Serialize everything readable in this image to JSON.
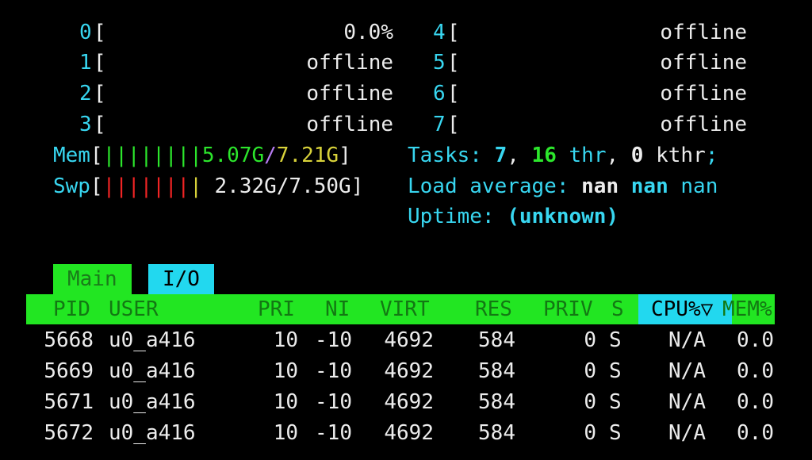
{
  "cpus": [
    {
      "id": "0",
      "value": "0.0%"
    },
    {
      "id": "1",
      "value": "offline"
    },
    {
      "id": "2",
      "value": "offline"
    },
    {
      "id": "3",
      "value": "offline"
    },
    {
      "id": "4",
      "value": "offline"
    },
    {
      "id": "5",
      "value": "offline"
    },
    {
      "id": "6",
      "value": "offline"
    },
    {
      "id": "7",
      "value": "offline"
    }
  ],
  "meters": {
    "mem": {
      "label": "Mem",
      "bars": "||||||||",
      "used": "5.07G",
      "sep": "/",
      "total": "7.21G"
    },
    "swp": {
      "label": "Swp",
      "bars_red": "|||||||",
      "bars_yellow": "|",
      "value": "2.32G/7.50G"
    }
  },
  "info": {
    "tasks_label": "Tasks: ",
    "tasks_count": "7",
    "tasks_comma1": ", ",
    "threads": "16",
    "threads_label": " thr",
    "tasks_comma2": ", ",
    "kthreads": "0",
    "kthreads_label": " kthr",
    "tasks_end": ";",
    "load_label": "Load average: ",
    "load_1": "nan",
    "load_5": "nan",
    "load_15": "nan",
    "uptime_label": "Uptime: ",
    "uptime_value": "(unknown)"
  },
  "tabs": {
    "main": "Main",
    "io": "I/O"
  },
  "columns": {
    "pid": "PID",
    "user": "USER",
    "pri": "PRI",
    "ni": "NI",
    "virt": "VIRT",
    "res": "RES",
    "priv": "PRIV",
    "s": "S",
    "cpu": "CPU%▽",
    "mem": "MEM%"
  },
  "processes": [
    {
      "pid": "5668",
      "user": "u0_a416",
      "pri": "10",
      "ni": "-10",
      "virt": "4692",
      "res": "584",
      "priv": "0",
      "s": "S",
      "cpu": "N/A",
      "mem": "0.0"
    },
    {
      "pid": "5669",
      "user": "u0_a416",
      "pri": "10",
      "ni": "-10",
      "virt": "4692",
      "res": "584",
      "priv": "0",
      "s": "S",
      "cpu": "N/A",
      "mem": "0.0"
    },
    {
      "pid": "5671",
      "user": "u0_a416",
      "pri": "10",
      "ni": "-10",
      "virt": "4692",
      "res": "584",
      "priv": "0",
      "s": "S",
      "cpu": "N/A",
      "mem": "0.0"
    },
    {
      "pid": "5672",
      "user": "u0_a416",
      "pri": "10",
      "ni": "-10",
      "virt": "4692",
      "res": "584",
      "priv": "0",
      "s": "S",
      "cpu": "N/A",
      "mem": "0.0"
    }
  ],
  "colors": {
    "cyan": "#38d6f0",
    "green": "#22e622",
    "red": "#f02424",
    "yellow": "#d8d23a",
    "violet": "#b77cf2"
  }
}
